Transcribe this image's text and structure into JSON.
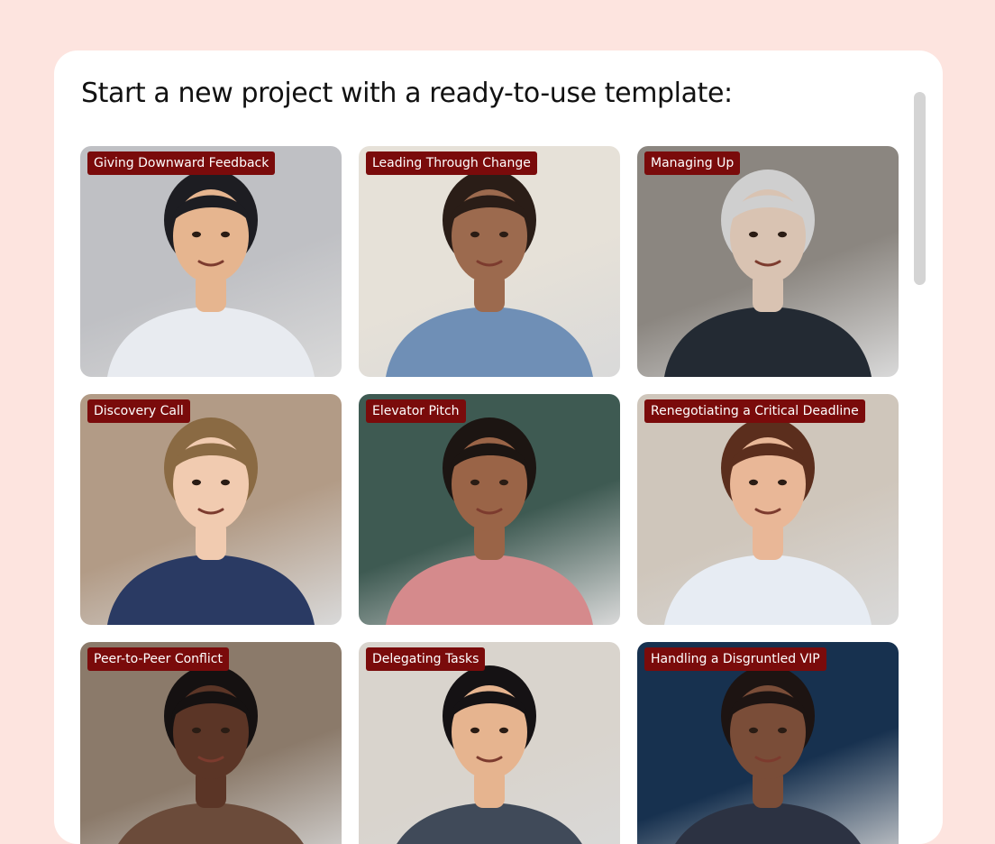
{
  "page": {
    "title": "Start a new project with a ready-to-use template:"
  },
  "templates": [
    {
      "label": "Giving Downward Feedback",
      "background": "#bfc0c4",
      "skin": "#e6b58f",
      "hair": "#1d1d22",
      "shirt": "#e8ebf0"
    },
    {
      "label": "Leading Through Change",
      "background": "#e6e1d8",
      "skin": "#9c6a4e",
      "hair": "#2a1d17",
      "shirt": "#6f8fb6"
    },
    {
      "label": "Managing Up",
      "background": "#8b8680",
      "skin": "#d9c3b2",
      "hair": "#cfcfcf",
      "shirt": "#232a33"
    },
    {
      "label": "Discovery Call",
      "background": "#b29b86",
      "skin": "#f1cbb0",
      "hair": "#8a6a43",
      "shirt": "#2a3a63"
    },
    {
      "label": "Elevator Pitch",
      "background": "#3e5a52",
      "skin": "#9a6447",
      "hair": "#1c1512",
      "shirt": "#d58a8c"
    },
    {
      "label": "Renegotiating a Critical Deadline",
      "background": "#cfc6bb",
      "skin": "#e9b797",
      "hair": "#5b2e1d",
      "shirt": "#e7ecf3"
    },
    {
      "label": "Peer-to-Peer Conflict",
      "background": "#8b7a6a",
      "skin": "#5b3526",
      "hair": "#151111",
      "shirt": "#6b4b3a"
    },
    {
      "label": "Delegating Tasks",
      "background": "#d9d4cd",
      "skin": "#e6b48f",
      "hair": "#151214",
      "shirt": "#404a59"
    },
    {
      "label": "Handling a Disgruntled VIP",
      "background": "#17314f",
      "skin": "#7a4d38",
      "hair": "#1d1412",
      "shirt": "#2c3242"
    }
  ]
}
